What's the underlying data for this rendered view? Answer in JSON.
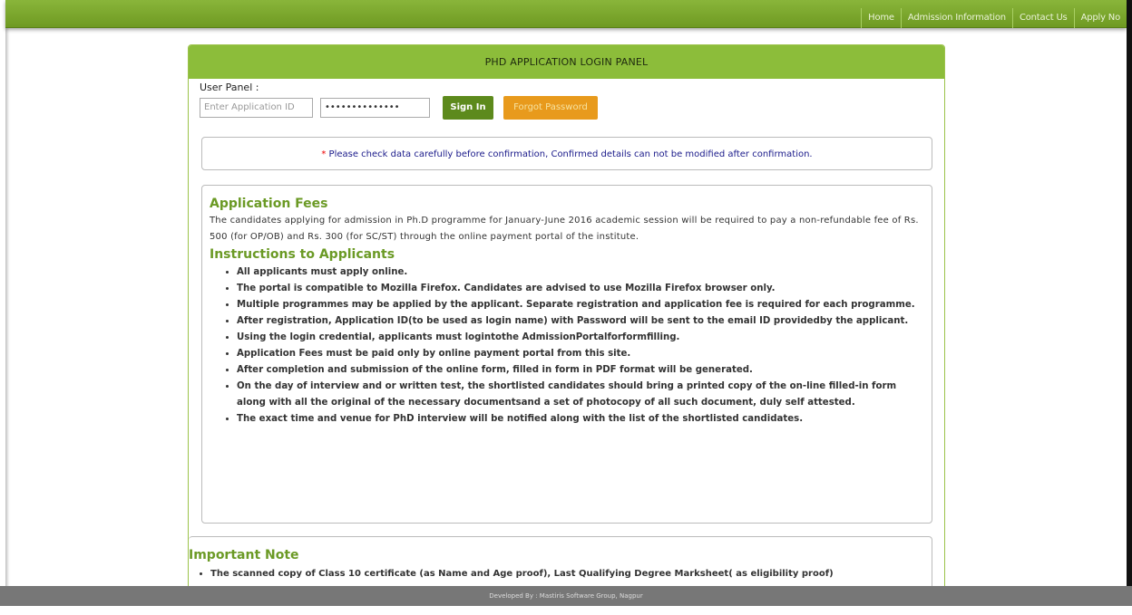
{
  "nav": {
    "items": [
      "Home",
      "Admission Information",
      "Contact Us",
      "Apply No"
    ]
  },
  "panel": {
    "title": "PHD APPLICATION LOGIN PANEL",
    "user_panel_label": "User Panel :",
    "app_id_placeholder": "Enter Application ID",
    "password_value": "••••••••••••••",
    "sign_in_label": "Sign In",
    "forgot_label": "Forgot Password"
  },
  "notice": {
    "star": "*",
    "text": " Please check data carefully before confirmation, Confirmed details can not be modified after confirmation."
  },
  "fees": {
    "heading": "Application Fees",
    "text": "The candidates applying for admission in Ph.D programme for January-June 2016 academic session will be required to pay a non-refundable fee of Rs. 500 (for OP/OB) and Rs. 300 (for SC/ST) through the online payment portal of the institute."
  },
  "instructions": {
    "heading": "Instructions to Applicants",
    "items": [
      "All applicants must apply online.",
      "The portal is compatible to Mozilla Firefox. Candidates are advised to use Mozilla Firefox browser only.",
      "Multiple programmes may be applied by the applicant. Separate registration and application fee is required for each programme.",
      "After registration, Application ID(to be used as login name) with Password will be sent to the email ID providedby the applicant.",
      "Using the login credential, applicants must logintothe AdmissionPortalforformfilling.",
      "Application Fees must be paid only by online payment portal from this site.",
      "After completion and submission of the online form, filled in form in PDF format will be generated.",
      "On the day of interview and or written test, the shortlisted candidates should bring a printed copy of the on-line filled-in form along with all the original of the necessary documentsand a set of photocopy of all such document, duly self attested.",
      "The exact time and venue for PhD interview will be notified along with the list of the shortlisted candidates."
    ]
  },
  "important": {
    "heading": "Important Note",
    "items": [
      "The scanned copy of Class 10 certificate (as Name and Age proof), Last Qualifying Degree Marksheet( as eligibility proof)"
    ]
  },
  "footer": {
    "text": "Developed By : Mastiris Software Group, Nagpur"
  },
  "colors": {
    "topbar": "#7aa62c",
    "panel_head": "#8cbd3a",
    "heading_green": "#6b9a25",
    "sign_in": "#5d8a1c",
    "forgot": "#e89a1c",
    "footer": "#777777"
  }
}
